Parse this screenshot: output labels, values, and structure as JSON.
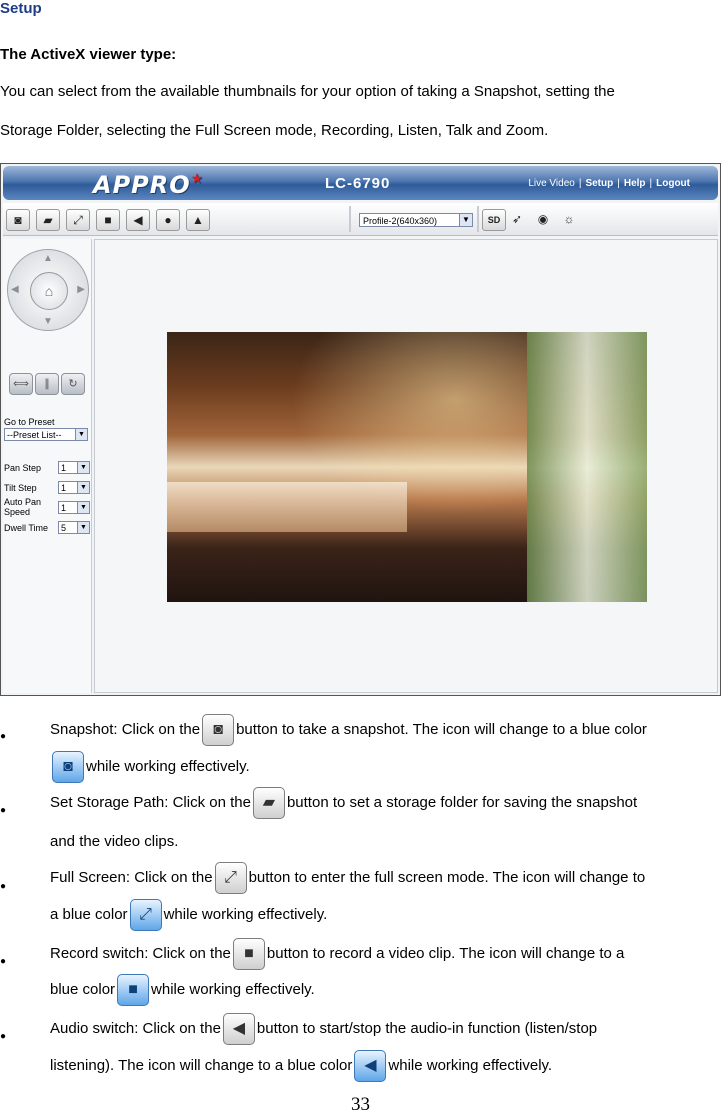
{
  "heading": "Setup",
  "subheading": "The ActiveX viewer type:",
  "intro_line1": "You can select from the available thumbnails for your option of taking a Snapshot, setting the",
  "intro_line2": "Storage Folder, selecting the Full Screen mode, Recording, Listen, Talk and Zoom.",
  "screenshot": {
    "logo": "APPRO",
    "model": "LC-6790",
    "nav": [
      "Live Video",
      "Setup",
      "Help",
      "Logout"
    ],
    "nav_sep": "|",
    "profile": "Profile-2(640x360)",
    "sd_label": "SD",
    "go_to_preset_label": "Go to Preset",
    "preset_value": "--Preset List--",
    "pan_step_label": "Pan Step",
    "pan_step_value": "1",
    "tilt_step_label": "Tilt Step",
    "tilt_step_value": "1",
    "auto_pan_label_1": "Auto Pan",
    "auto_pan_label_2": "Speed",
    "auto_pan_value": "1",
    "dwell_time_label": "Dwell Time",
    "dwell_time_value": "5"
  },
  "bullets": [
    {
      "a": "Snapshot: Click on the",
      "b": "button to take a snapshot. The icon will change to a blue color",
      "c": "while working effectively."
    },
    {
      "a": "Set Storage Path: Click on the",
      "b": "button to set a storage folder for saving the snapshot",
      "c": "and the video clips."
    },
    {
      "a": "Full Screen: Click on the",
      "b": "button to enter the full screen mode. The icon will change to",
      "c": "a blue color",
      "d": "while working effectively."
    },
    {
      "a": "Record switch: Click on the",
      "b": "button to record a video clip. The icon will change to a",
      "c": "blue color",
      "d": "while working effectively."
    },
    {
      "a": "Audio switch: Click on the",
      "b": "button to start/stop the audio-in function (listen/stop",
      "c": "listening). The icon will change to a blue color",
      "d": "while working effectively."
    }
  ],
  "bullet_glyph": "●",
  "page_number": "33",
  "icons": [
    "camera-icon",
    "folder-icon",
    "fullscreen-icon",
    "record-icon",
    "speaker-icon",
    "microphone-icon",
    "zoom-icon",
    "motion-icon",
    "target-icon",
    "alarm-icon"
  ]
}
